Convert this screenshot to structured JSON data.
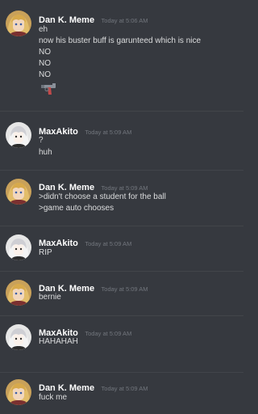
{
  "messages": [
    {
      "author": "Dan K. Meme",
      "timestamp": "Today at 5:06 AM",
      "lines": [
        "eh",
        "now his buster buff is garunteed which is nice",
        "NO",
        "NO",
        "NO"
      ],
      "emoji": "gun-emoji"
    },
    {
      "author": "MaxAkito",
      "timestamp": "Today at 5:09 AM",
      "lines": [
        "?",
        "huh"
      ]
    },
    {
      "author": "Dan K. Meme",
      "timestamp": "Today at 5:09 AM",
      "lines": [
        ">didn't choose a student for the ball",
        ">game auto chooses"
      ]
    },
    {
      "author": "MaxAkito",
      "timestamp": "Today at 5:09 AM",
      "lines": [
        "RIP"
      ]
    },
    {
      "author": "Dan K. Meme",
      "timestamp": "Today at 5:09 AM",
      "lines": [
        "bernie"
      ]
    },
    {
      "author": "MaxAkito",
      "timestamp": "Today at 5:09 AM",
      "lines": [
        "HAHAHAH"
      ]
    },
    {
      "author": "Dan K. Meme",
      "timestamp": "Today at 5:09 AM",
      "lines": [
        "fuck me"
      ]
    }
  ],
  "colors": {
    "background": "#36393f",
    "username": "#ffffff",
    "text": "#dcddde",
    "timestamp": "#72767d",
    "divider": "#42454a"
  }
}
